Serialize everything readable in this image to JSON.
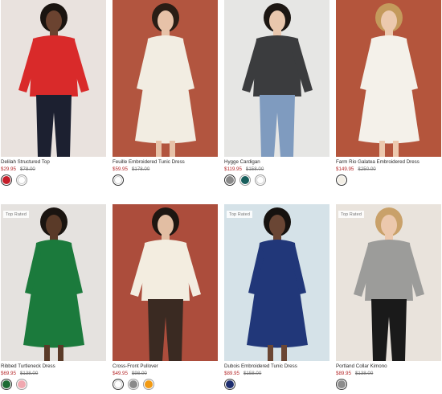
{
  "products": [
    {
      "name": "Delilah Structured Top",
      "sale_price": "$29.95",
      "orig_price": "$78.00",
      "badge": "",
      "swatches": [
        "#c51e2a",
        "#ffffff"
      ],
      "bg": "#e9e2de",
      "garment": "#d92a2a"
    },
    {
      "name": "Feuille Embroidered Tunic Dress",
      "sale_price": "$59.95",
      "orig_price": "$178.00",
      "badge": "",
      "swatches": [
        "#ffffff"
      ],
      "bg": "#b2553f",
      "garment": "#f2ede2"
    },
    {
      "name": "Hygge Cardigan",
      "sale_price": "$119.95",
      "orig_price": "$158.00",
      "badge": "",
      "swatches": [
        "#8a8a8a",
        "#185e5c",
        "#ffffff"
      ],
      "bg": "#e6e6e4",
      "garment": "#3b3c3e"
    },
    {
      "name": "Farm Rio Galatea Embroidered Dress",
      "sale_price": "$149.95",
      "orig_price": "$250.00",
      "badge": "",
      "swatches": [
        "#f3efe6"
      ],
      "bg": "#b4553c",
      "garment": "#f4f1ea"
    },
    {
      "name": "Ribbed Turtleneck Dress",
      "sale_price": "$69.95",
      "orig_price": "$138.00",
      "badge": "Top Rated",
      "swatches": [
        "#1d6b33",
        "#f0a8b0"
      ],
      "bg": "#e5e2df",
      "garment": "#1b7a3c"
    },
    {
      "name": "Cross-Front Pullover",
      "sale_price": "$49.95",
      "orig_price": "$98.00",
      "badge": "",
      "swatches": [
        "#ffffff",
        "#8a8a8a",
        "#f29a12"
      ],
      "bg": "#ac4d3c",
      "garment": "#f3ede0"
    },
    {
      "name": "Dubois Embroidered Tunic Dress",
      "sale_price": "$89.95",
      "orig_price": "$158.00",
      "badge": "Top Rated",
      "swatches": [
        "#1d2d6e"
      ],
      "bg": "#d5e2e8",
      "garment": "#213779"
    },
    {
      "name": "Portland Collar Kimono",
      "sale_price": "$89.95",
      "orig_price": "$138.00",
      "badge": "Top Rated",
      "swatches": [
        "#8c8c8c"
      ],
      "bg": "#e9e3dc",
      "garment": "#9c9c9a"
    }
  ]
}
